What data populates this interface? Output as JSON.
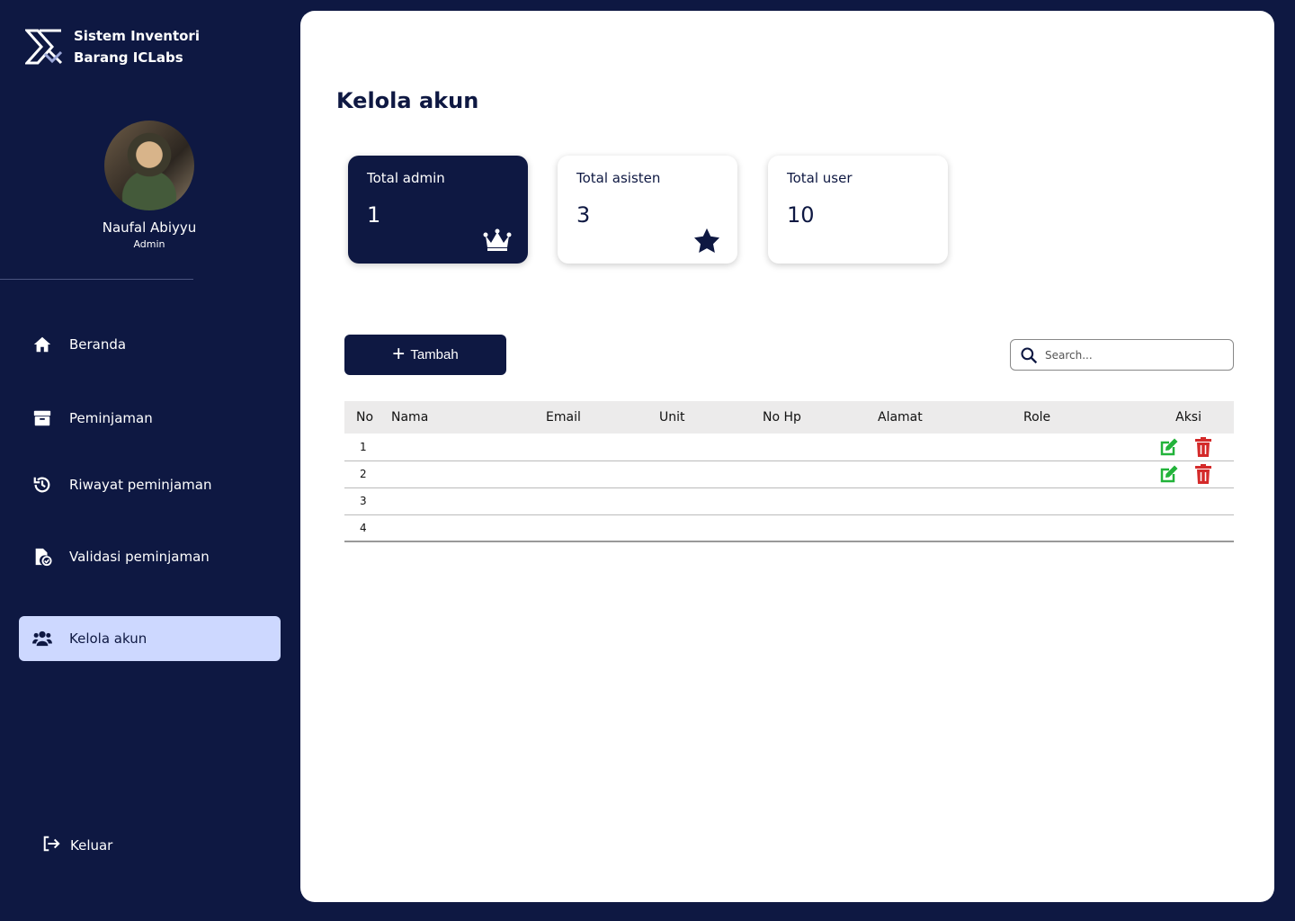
{
  "brand": {
    "line1": "Sistem Inventori",
    "line2": "Barang ICLabs"
  },
  "profile": {
    "name": "Naufal Abiyyu",
    "role": "Admin"
  },
  "sidebar": {
    "items": [
      {
        "label": "Beranda",
        "icon": "home-icon"
      },
      {
        "label": "Peminjaman",
        "icon": "box-icon"
      },
      {
        "label": "Riwayat peminjaman",
        "icon": "history-icon"
      },
      {
        "label": "Validasi peminjaman",
        "icon": "file-check-icon"
      },
      {
        "label": "Kelola akun",
        "icon": "users-icon",
        "active": true
      }
    ],
    "logout_label": "Keluar"
  },
  "main": {
    "title": "Kelola akun",
    "cards": [
      {
        "label": "Total admin",
        "value": "1",
        "icon": "crown-icon"
      },
      {
        "label": "Total asisten",
        "value": "3",
        "icon": "star-icon"
      },
      {
        "label": "Total user",
        "value": "10"
      }
    ],
    "add_label": "Tambah",
    "search_placeholder": "Search...",
    "table": {
      "headers": [
        "No",
        "Nama",
        "Email",
        "Unit",
        "No Hp",
        "Alamat",
        "Role",
        "Aksi"
      ],
      "rows": [
        {
          "no": "1",
          "has_actions": true
        },
        {
          "no": "2",
          "has_actions": true
        },
        {
          "no": "3",
          "has_actions": false
        },
        {
          "no": "4",
          "has_actions": false
        }
      ]
    }
  },
  "colors": {
    "navy": "#0e1842",
    "active_nav": "#cdd8ff",
    "edit": "#22b33a",
    "delete": "#d42a2a"
  }
}
